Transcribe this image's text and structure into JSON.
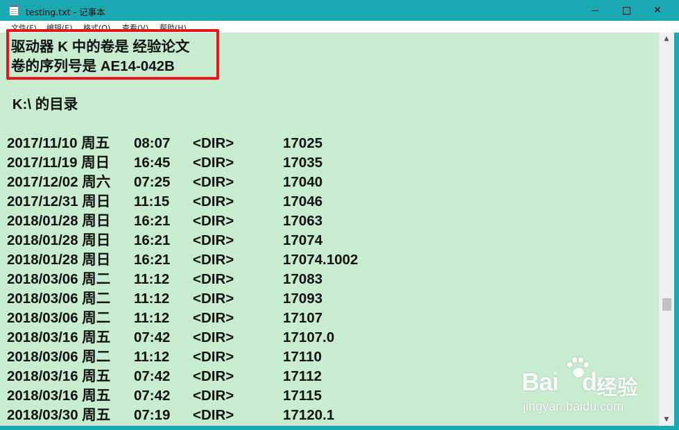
{
  "window": {
    "title": "testing.txt - 记事本"
  },
  "menu": [
    "文件(F)",
    "编辑(E)",
    "格式(O)",
    "查看(V)",
    "帮助(H)"
  ],
  "header": {
    "line1": "驱动器 K 中的卷是 经验论文",
    "line2": "卷的序列号是 AE14-042B",
    "directory": " K:\\ 的目录"
  },
  "rows": [
    {
      "date": "2017/11/10 周五",
      "time": "08:07",
      "type": "<DIR>",
      "name": "17025"
    },
    {
      "date": "2017/11/19 周日",
      "time": "16:45",
      "type": "<DIR>",
      "name": "17035"
    },
    {
      "date": "2017/12/02 周六",
      "time": "07:25",
      "type": "<DIR>",
      "name": "17040"
    },
    {
      "date": "2017/12/31 周日",
      "time": "11:15",
      "type": "<DIR>",
      "name": "17046"
    },
    {
      "date": "2018/01/28 周日",
      "time": "16:21",
      "type": "<DIR>",
      "name": "17063"
    },
    {
      "date": "2018/01/28 周日",
      "time": "16:21",
      "type": "<DIR>",
      "name": "17074"
    },
    {
      "date": "2018/01/28 周日",
      "time": "16:21",
      "type": "<DIR>",
      "name": "17074.1002"
    },
    {
      "date": "2018/03/06 周二",
      "time": "11:12",
      "type": "<DIR>",
      "name": "17083"
    },
    {
      "date": "2018/03/06 周二",
      "time": "11:12",
      "type": "<DIR>",
      "name": "17093"
    },
    {
      "date": "2018/03/06 周二",
      "time": "11:12",
      "type": "<DIR>",
      "name": "17107"
    },
    {
      "date": "2018/03/16 周五",
      "time": "07:42",
      "type": "<DIR>",
      "name": "17107.0"
    },
    {
      "date": "2018/03/06 周二",
      "time": "11:12",
      "type": "<DIR>",
      "name": "17110"
    },
    {
      "date": "2018/03/16 周五",
      "time": "07:42",
      "type": "<DIR>",
      "name": "17112"
    },
    {
      "date": "2018/03/16 周五",
      "time": "07:42",
      "type": "<DIR>",
      "name": "17115"
    },
    {
      "date": "2018/03/30 周五",
      "time": "07:19",
      "type": "<DIR>",
      "name": "17120.1"
    }
  ],
  "watermark": {
    "brand": "Bai",
    "brand_suffix": "du",
    "label": "经验",
    "url": "jingyan.baidu.com"
  },
  "colors": {
    "editor_bg": "#c8ecd0",
    "frame": "#1aa9b3",
    "highlight": "#e8141b"
  }
}
